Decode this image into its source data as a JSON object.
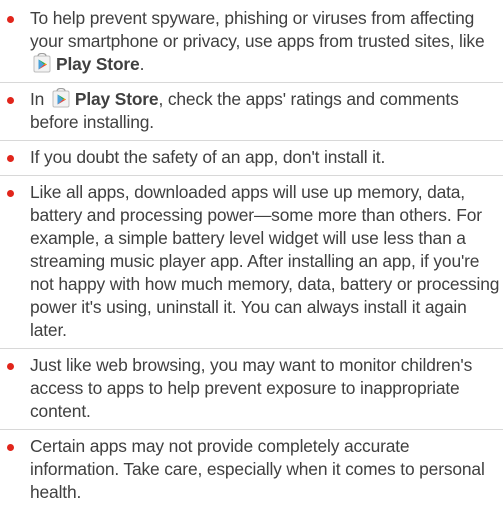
{
  "colors": {
    "bullet": "#e1251b",
    "text": "#404040"
  },
  "icons": {
    "play_store": "play-store-icon"
  },
  "items": [
    {
      "text_before": "To help prevent spyware, phishing or viruses from affecting your smartphone or privacy, use apps from trusted sites, like ",
      "link": "Play Store",
      "text_after": "."
    },
    {
      "text_before": "In ",
      "link": "Play Store",
      "text_after": ", check the apps' ratings and comments before installing."
    },
    {
      "text": "If you doubt the safety of an app, don't install it."
    },
    {
      "text": "Like all apps, downloaded apps will use up memory, data, battery and processing power—some more than others. For example, a simple battery level widget will use less than a streaming music player app. After installing an app, if you're not happy with how much memory, data, battery or processing power it's using, uninstall it. You can always install it again later."
    },
    {
      "text": "Just like web browsing, you may want to monitor children's access to apps to help prevent exposure to inappropriate content."
    },
    {
      "text": "Certain apps may not provide completely accurate information. Take care, especially when it comes to personal health."
    }
  ]
}
